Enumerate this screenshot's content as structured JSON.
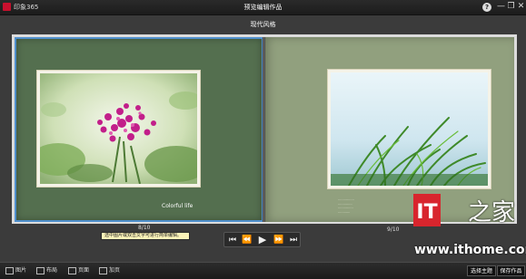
{
  "window": {
    "app_name": "印象365",
    "title": "预览编辑作品",
    "help_icon": "help-icon",
    "help_glyph": "?",
    "minimize_glyph": "—",
    "restore_glyph": "❐",
    "close_glyph": "✕"
  },
  "album": {
    "theme_title": "现代风格",
    "left_page": {
      "photo": "purple-flowers-photo",
      "caption": "Colorful life",
      "page_number": "8/10"
    },
    "right_page": {
      "photo": "green-grass-photo",
      "caption_lines": [
        "················",
        "··············",
        "···············",
        "············"
      ],
      "page_number": "9/10"
    }
  },
  "hint": "选中图片或双击文字可进行简单编辑。",
  "controls": {
    "first": "⏮",
    "prev": "⏪",
    "play": "▶",
    "next": "⏩",
    "last": "⏭"
  },
  "watermark": {
    "logo_text": "IT",
    "url": "www.ithome.com",
    "brand": "之家"
  },
  "toolbar": {
    "photos": "图片",
    "layout": "布局",
    "pages": "页面",
    "additional_pages": "加页",
    "choose_theme": "选择主题",
    "save_work": "保存作品"
  },
  "colors": {
    "left_page_bg": "#546f4f",
    "right_page_bg": "#91a07e",
    "selection_border": "#4f8fcc",
    "hint_bg": "#fbf3b8",
    "watermark_red": "#d8252d"
  }
}
